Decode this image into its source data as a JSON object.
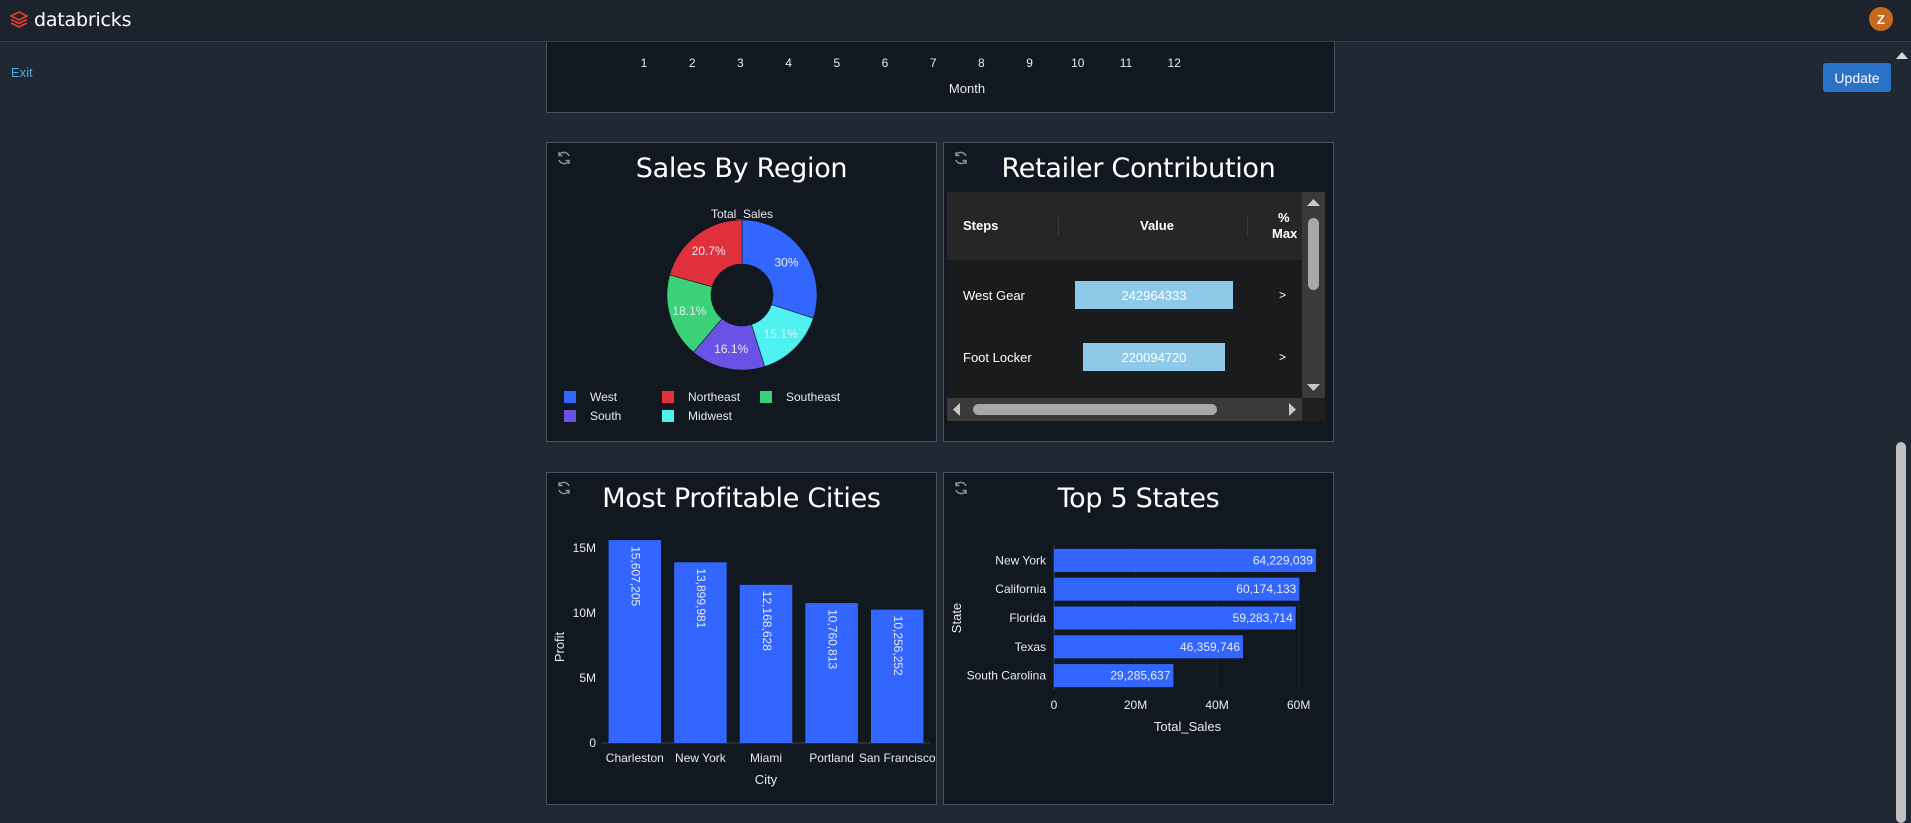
{
  "app": {
    "name": "databricks",
    "user_initial": "Z"
  },
  "actions": {
    "exit_label": "Exit",
    "update_label": "Update"
  },
  "month_panel": {
    "months": [
      "1",
      "2",
      "3",
      "4",
      "5",
      "6",
      "7",
      "8",
      "9",
      "10",
      "11",
      "12"
    ],
    "xlabel": "Month"
  },
  "sales_by_region": {
    "title": "Sales By Region",
    "subtitle": "Total_Sales",
    "legend": [
      "West",
      "Northeast",
      "Southeast",
      "South",
      "Midwest"
    ]
  },
  "retailer_contribution": {
    "title": "Retailer Contribution",
    "columns": [
      "Steps",
      "Value",
      "%",
      "Max"
    ],
    "rows": [
      {
        "step": "West Gear",
        "value": "242964333",
        "arrow": ">",
        "fraction": 1.0
      },
      {
        "step": "Foot Locker",
        "value": "220094720",
        "arrow": ">",
        "fraction": 0.906
      }
    ]
  },
  "most_profitable_cities": {
    "title": "Most Profitable Cities"
  },
  "top5_states": {
    "title": "Top 5 States"
  },
  "chart_data": [
    {
      "type": "pie",
      "title": "Sales By Region",
      "subtitle": "Total_Sales",
      "categories": [
        "West",
        "Midwest",
        "South",
        "Southeast",
        "Northeast"
      ],
      "values": [
        30,
        15.1,
        16.1,
        18.1,
        20.7
      ],
      "labels": [
        "30%",
        "15.1%",
        "16.1%",
        "18.1%",
        "20.7%"
      ],
      "colors": [
        "#3366ff",
        "#4ef0f0",
        "#6a52e6",
        "#3ad178",
        "#e0303c"
      ],
      "legend_position": "bottom"
    },
    {
      "type": "bar",
      "title": "Most Profitable Cities",
      "categories": [
        "Charleston",
        "New York",
        "Miami",
        "Portland",
        "San Francisco"
      ],
      "values": [
        15607205,
        13899981,
        12168628,
        10760813,
        10256252
      ],
      "labels": [
        "15,607,205",
        "13,899,981",
        "12,168,628",
        "10,760,813",
        "10,256,252"
      ],
      "xlabel": "City",
      "ylabel": "Profit",
      "yticks": [
        "0",
        "5M",
        "10M",
        "15M"
      ],
      "ylim": [
        0,
        16000000
      ],
      "color": "#3366ff"
    },
    {
      "type": "bar",
      "orientation": "horizontal",
      "title": "Top 5 States",
      "categories": [
        "New York",
        "California",
        "Florida",
        "Texas",
        "South Carolina"
      ],
      "values": [
        64229039,
        60174133,
        59283714,
        46359746,
        29285637
      ],
      "labels": [
        "64,229,039",
        "60,174,133",
        "59,283,714",
        "46,359,746",
        "29,285,637"
      ],
      "xlabel": "Total_Sales",
      "ylabel": "State",
      "xticks": [
        "0",
        "20M",
        "40M",
        "60M"
      ],
      "xlim": [
        0,
        64500000
      ],
      "color": "#3366ff"
    }
  ]
}
